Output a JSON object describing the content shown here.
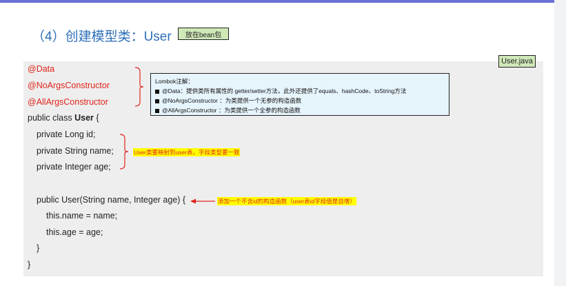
{
  "heading": {
    "title": "（4）创建模型类：User",
    "tag": "放在bean包"
  },
  "file_tag": "User.java",
  "code": {
    "annotations": [
      "@Data",
      "@NoArgsConstructor",
      "@AllArgsConstructor"
    ],
    "class_decl_prefix": "public class ",
    "class_name": "User",
    "class_decl_suffix": " {",
    "fields": [
      "private Long id;",
      "private String name;",
      "private Integer age;"
    ],
    "constructor_sig": "public User(String name, Integer age) {",
    "constructor_body": [
      "this.name = name;",
      "this.age = age;"
    ],
    "close_inner": "}",
    "close_outer": "}"
  },
  "callout": {
    "title": "Lombok注解：",
    "items": [
      "@Data：提供类所有属性的 getter/setter方法，此外还提供了equals、hashCode、toString方法",
      "@NoArgsConstructor ：为类提供一个无参的构造函数",
      "@AllArgsConstructor ：为类提供一个全参的构造函数"
    ]
  },
  "notes": {
    "fields_note": "User类要映射到user表，字段类型要一致",
    "constructor_note": "添加一个不含id的构造函数（user表id字段值是自增）"
  },
  "colors": {
    "heading": "#2f6fb8",
    "annotation": "#e0241b",
    "tag_bg": "#cfe8b8",
    "callout_bg": "#e6f4fb",
    "highlight": "#ffff00",
    "top_bar": "#6b6fd6"
  }
}
